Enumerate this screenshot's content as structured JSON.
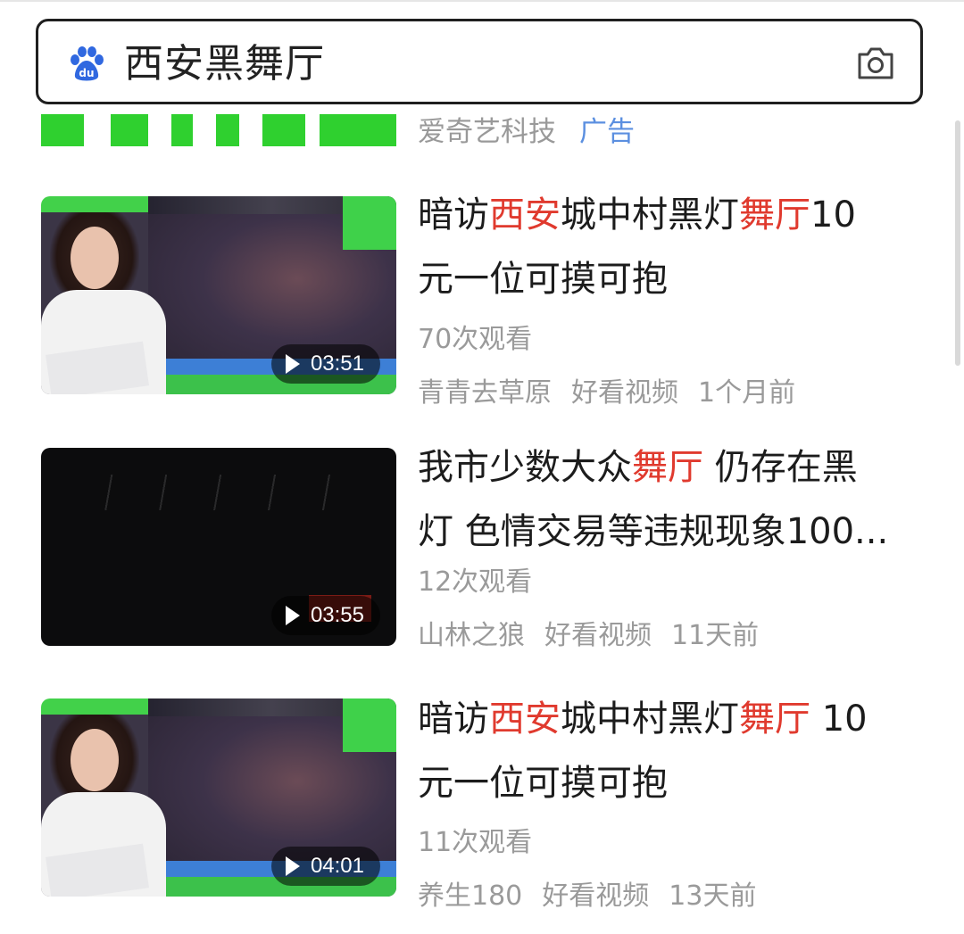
{
  "search": {
    "query": "西安黑舞厅",
    "logo_icon": "baidu-paw-icon",
    "camera_icon": "camera-icon"
  },
  "ad": {
    "source": "爱奇艺科技",
    "tag": "广告",
    "accent_color": "#2fd02f"
  },
  "videos": [
    {
      "title_parts": [
        {
          "text": "暗访",
          "hl": false
        },
        {
          "text": "西安",
          "hl": true
        },
        {
          "text": "城中村黑灯",
          "hl": false
        },
        {
          "text": "舞厅",
          "hl": true
        },
        {
          "text": "10",
          "hl": false
        }
      ],
      "title_line2": "元一位可摸可抱",
      "views": "70次观看",
      "author": "青青去草原",
      "platform": "好看视频",
      "time": "1个月前",
      "duration": "03:51",
      "thumb_style": "news"
    },
    {
      "title_parts": [
        {
          "text": "我市少数大众",
          "hl": false
        },
        {
          "text": "舞厅",
          "hl": true
        },
        {
          "text": " 仍存在黑",
          "hl": false
        }
      ],
      "title_line2": "灯 色情交易等违规现象100...",
      "views": "12次观看",
      "author": "山林之狼",
      "platform": "好看视频",
      "time": "11天前",
      "duration": "03:55",
      "thumb_style": "dark"
    },
    {
      "title_parts": [
        {
          "text": "暗访",
          "hl": false
        },
        {
          "text": "西安",
          "hl": true
        },
        {
          "text": "城中村黑灯",
          "hl": false
        },
        {
          "text": "舞厅",
          "hl": true
        },
        {
          "text": " 10",
          "hl": false
        }
      ],
      "title_line2": "元一位可摸可抱",
      "views": "11次观看",
      "author": "养生180",
      "platform": "好看视频",
      "time": "13天前",
      "duration": "04:01",
      "thumb_style": "news"
    }
  ],
  "colors": {
    "highlight": "#e03a2e",
    "meta_text": "#9a9a9a",
    "ad_tag": "#5b8fe0"
  }
}
